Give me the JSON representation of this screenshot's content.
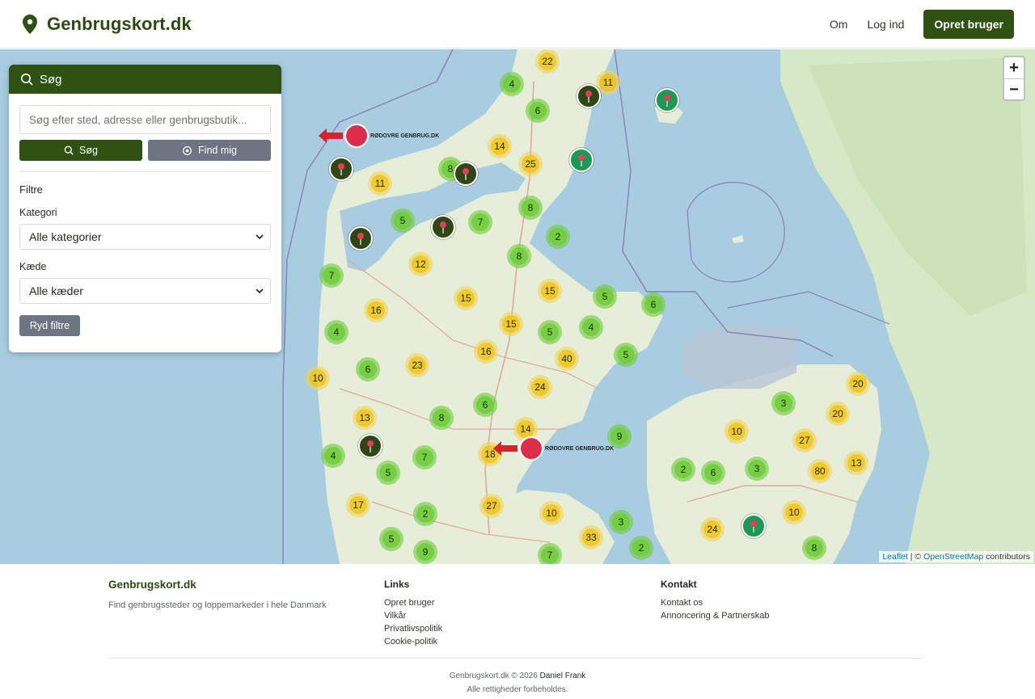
{
  "header": {
    "brand": "Genbrugskort.dk",
    "nav": {
      "about": "Om",
      "login": "Log ind",
      "signup": "Opret bruger"
    }
  },
  "search_panel": {
    "title": "Søg",
    "input_placeholder": "Søg efter sted, adresse eller genbrugsbutik...",
    "search_button": "Søg",
    "locate_button": "Find mig",
    "filters_title": "Filtre",
    "category_label": "Kategori",
    "category_value": "Alle kategorier",
    "chain_label": "Kæde",
    "chain_value": "Alle kæder",
    "reset_button": "Ryd filtre"
  },
  "map": {
    "zoom_in": "+",
    "zoom_out": "−",
    "attribution_leaflet": "Leaflet",
    "attribution_sep": " | © ",
    "attribution_osm": "OpenStreetMap",
    "attribution_suffix": " contributors",
    "ad_label": "RØDOVRE GENBRUG.DK",
    "clusters_green": [
      "4",
      "6",
      "8",
      "5",
      "7",
      "8",
      "2",
      "8",
      "7",
      "5",
      "6",
      "5",
      "4",
      "4",
      "6",
      "5",
      "6",
      "8",
      "3",
      "4",
      "7",
      "5",
      "2",
      "6",
      "3",
      "9",
      "2",
      "5",
      "9",
      "3",
      "8",
      "2",
      "7"
    ],
    "clusters_yellow": [
      "22",
      "11",
      "14",
      "25",
      "11",
      "12",
      "16",
      "15",
      "15",
      "15",
      "16",
      "40",
      "23",
      "24",
      "10",
      "13",
      "14",
      "18",
      "27",
      "17",
      "10",
      "33",
      "24",
      "20",
      "10",
      "27",
      "80",
      "13",
      "20",
      "10"
    ]
  },
  "footer": {
    "brand": "Genbrugskort.dk",
    "tagline": "Find genbrugssteder og loppemarkeder i hele Danmark",
    "links_title": "Links",
    "links": [
      "Opret bruger",
      "Vilkår",
      "Privatlivspolitik",
      "Cookie-politik"
    ],
    "contact_title": "Kontakt",
    "contact_links": [
      "Kontakt os",
      "Annoncering & Partnerskab"
    ],
    "copyright": "Genbrugskort.dk © 2026",
    "author": "Daniel Frank",
    "rights": "Alle rettigheder forbeholdes."
  },
  "colors": {
    "brand_green": "#2f5213",
    "ad_red": "#dc2e4b",
    "pin_teal": "#1a9a55",
    "water": "#a9cde0"
  }
}
